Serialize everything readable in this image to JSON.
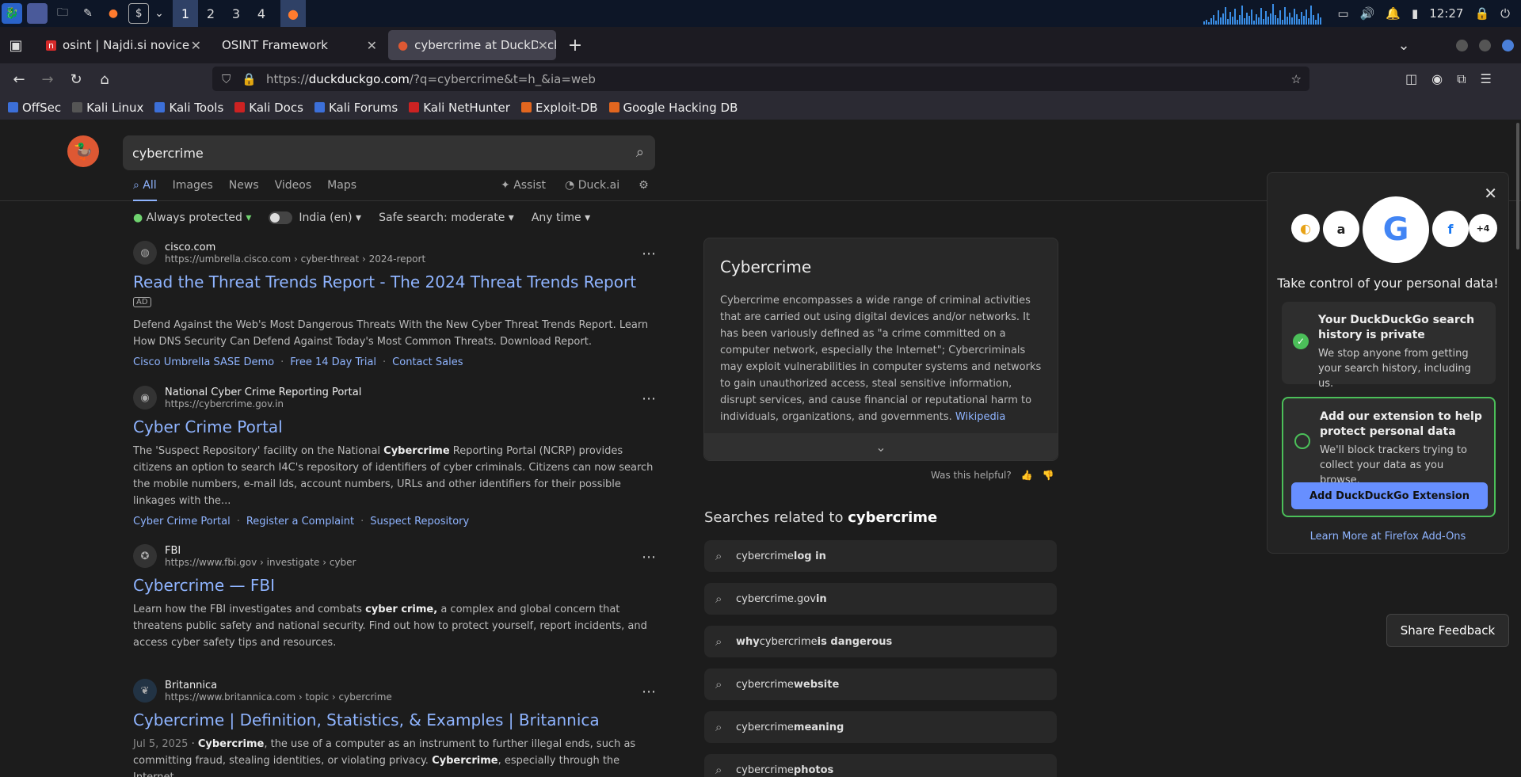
{
  "taskbar": {
    "workspaces": [
      "1",
      "2",
      "3",
      "4"
    ],
    "clock": "12:27"
  },
  "tabs": [
    {
      "title": "osint | Najdi.si novice"
    },
    {
      "title": "OSINT Framework"
    },
    {
      "title": "cybercrime at DuckDuckG"
    }
  ],
  "url": {
    "prefix": "https://",
    "host": "duckduckgo.com",
    "path": "/?q=cybercrime&t=h_&ia=web"
  },
  "bookmarks": [
    "OffSec",
    "Kali Linux",
    "Kali Tools",
    "Kali Docs",
    "Kali Forums",
    "Kali NetHunter",
    "Exploit-DB",
    "Google Hacking DB"
  ],
  "search": {
    "query": "cybercrime"
  },
  "verticals": {
    "all": "All",
    "images": "Images",
    "news": "News",
    "videos": "Videos",
    "maps": "Maps",
    "assist": "Assist",
    "duckai": "Duck.ai"
  },
  "filters": {
    "protected": "Always protected",
    "region": "India (en)",
    "safe": "Safe search: moderate",
    "time": "Any time"
  },
  "results": [
    {
      "site": "cisco.com",
      "url": "https://umbrella.cisco.com › cyber-threat › 2024-report",
      "title": "Read the Threat Trends Report - The 2024 Threat Trends Report",
      "ad": "AD",
      "snippet": "Defend Against the Web's Most Dangerous Threats With the New Cyber Threat Trends Report. Learn How DNS Security Can Defend Against Today's Most Common Threats. Download Report.",
      "links": [
        "Cisco Umbrella SASE Demo",
        "Free 14 Day Trial",
        "Contact Sales"
      ]
    },
    {
      "site": "National Cyber Crime Reporting Portal",
      "url": "https://cybercrime.gov.in",
      "title": "Cyber Crime Portal",
      "snippet_a": "The 'Suspect Repository' facility on the National ",
      "snippet_b": "Cybercrime",
      "snippet_c": " Reporting Portal (NCRP) provides citizens an option to search I4C's repository of identifiers of cyber criminals. Citizens can now search the mobile numbers, e-mail Ids, account numbers, URLs and other identifiers for their possible linkages with the...",
      "links": [
        "Cyber Crime Portal",
        "Register a Complaint",
        "Suspect Repository"
      ]
    },
    {
      "site": "FBI",
      "url": "https://www.fbi.gov › investigate › cyber",
      "title": "Cybercrime — FBI",
      "snippet_a": "Learn how the FBI investigates and combats ",
      "snippet_b": "cyber crime,",
      "snippet_c": " a complex and global concern that threatens public safety and national security. Find out how to protect yourself, report incidents, and access cyber safety tips and resources."
    },
    {
      "site": "Britannica",
      "url": "https://www.britannica.com › topic › cybercrime",
      "title": "Cybercrime | Definition, Statistics, & Examples | Britannica",
      "date": "Jul 5, 2025",
      "snippet_b": "Cybercrime",
      "snippet_c": ", the use of a computer as an instrument to further illegal ends, such as committing fraud, stealing identities, or violating privacy. ",
      "snippet_d": "Cybercrime",
      "snippet_e": ", especially through the Internet,"
    }
  ],
  "knowledge": {
    "title": "Cybercrime",
    "text": "Cybercrime encompasses a wide range of criminal activities that are carried out using digital devices and/or networks. It has been variously defined as \"a crime committed on a computer network, especially the Internet\"; Cybercriminals may exploit vulnerabilities in computer systems and networks to gain unauthorized access, steal sensitive information, disrupt services, and cause financial or reputational harm to individuals, organizations, and governments.",
    "source": "Wikipedia",
    "helpful": "Was this helpful?"
  },
  "related": {
    "title_prefix": "Searches related to ",
    "title_term": "cybercrime",
    "items": [
      {
        "a": "cybercrime ",
        "b": "log in"
      },
      {
        "a": "cybercrime.gov ",
        "b": "in"
      },
      {
        "a": "why ",
        "b": "cybercrime",
        "c": " is dangerous"
      },
      {
        "a": "cybercrime ",
        "b": "website"
      },
      {
        "a": "cybercrime ",
        "b": "meaning"
      },
      {
        "a": "cybercrime ",
        "b": "photos"
      }
    ]
  },
  "privacy": {
    "more": "+4",
    "title": "Take control of your personal data!",
    "box1_title": "Your DuckDuckGo search history is private",
    "box1_text": "We stop anyone from getting your search history, including us.",
    "box2_title": "Add our extension to help protect personal data",
    "box2_text": "We'll block trackers trying to collect your data as you browse.",
    "button": "Add DuckDuckGo Extension",
    "learn": "Learn More at Firefox Add-Ons"
  },
  "feedback": "Share Feedback"
}
